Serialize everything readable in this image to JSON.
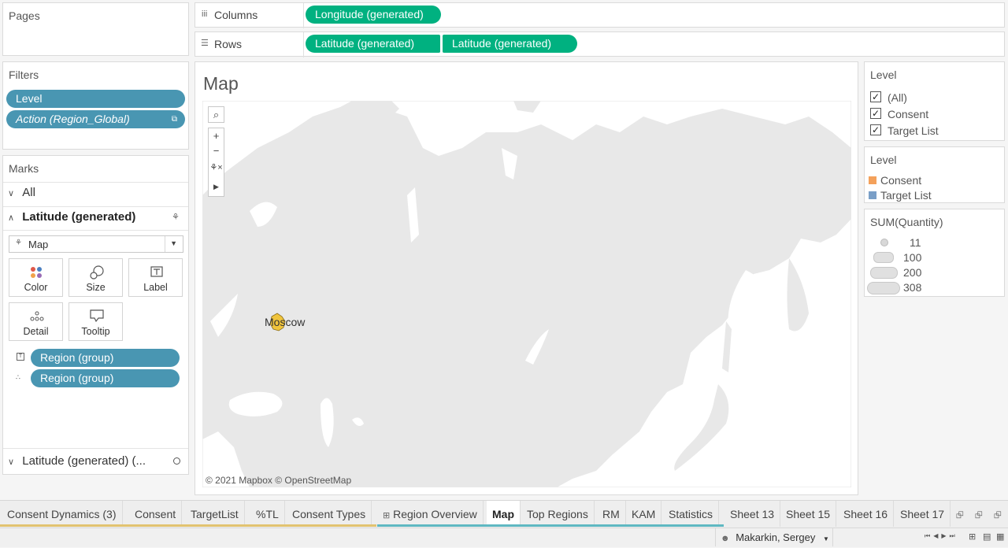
{
  "pages": {
    "title": "Pages"
  },
  "shelves": {
    "columns": {
      "label": "Columns",
      "pills": [
        "Longitude (generated)"
      ]
    },
    "rows": {
      "label": "Rows",
      "pills": [
        "Latitude (generated)",
        "Latitude (generated)"
      ]
    }
  },
  "filters": {
    "title": "Filters",
    "pills": [
      "Level",
      "Action (Region_Global)"
    ]
  },
  "marks": {
    "title": "Marks",
    "all_label": "All",
    "active_card": "Latitude (generated)",
    "mark_type": "Map",
    "buttons": {
      "color": "Color",
      "size": "Size",
      "label": "Label",
      "detail": "Detail",
      "tooltip": "Tooltip"
    },
    "fields": [
      "Region (group)",
      "Region (group)"
    ],
    "bottom_card": "Latitude (generated) (..."
  },
  "view": {
    "title": "Map",
    "city_label": "Moscow",
    "attribution": "© 2021 Mapbox © OpenStreetMap",
    "colors": {
      "land": "#e8e8e8",
      "water": "#ffffff",
      "mark": "#f0c43c"
    }
  },
  "level_filter": {
    "title": "Level",
    "items": [
      {
        "label": "(All)",
        "checked": true
      },
      {
        "label": "Consent",
        "checked": true
      },
      {
        "label": "Target List",
        "checked": true
      }
    ]
  },
  "level_color_legend": {
    "title": "Level",
    "items": [
      {
        "label": "Consent",
        "color": "#f4a15b"
      },
      {
        "label": "Target List",
        "color": "#7a9fc7"
      }
    ]
  },
  "size_legend": {
    "title": "SUM(Quantity)",
    "items": [
      "11",
      "100",
      "200",
      "308"
    ]
  },
  "tabs": [
    "Consent Dynamics (3)",
    "Consent",
    "TargetList",
    "%TL",
    "Consent Types",
    "Region Overview",
    "Map",
    "Top Regions",
    "RM",
    "KAM",
    "Statistics",
    "Sheet 13",
    "Sheet 15",
    "Sheet 16",
    "Sheet 17"
  ],
  "active_tab": "Map",
  "status": {
    "user": "Makarkin, Sergey"
  }
}
